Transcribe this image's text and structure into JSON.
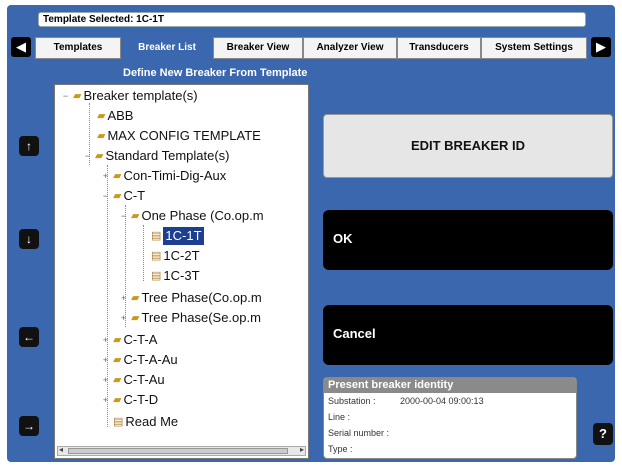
{
  "header": {
    "template_selected": "Template Selected: 1C-1T"
  },
  "tabs": [
    {
      "label": "Templates"
    },
    {
      "label": "Breaker List"
    },
    {
      "label": "Breaker View"
    },
    {
      "label": "Analyzer View"
    },
    {
      "label": "Transducers"
    },
    {
      "label": "System Settings"
    }
  ],
  "active_tab": "Breaker List",
  "subtitle": "Define New Breaker From Template",
  "side_buttons": [
    {
      "icon": "arrow-up-icon",
      "glyph": "↑"
    },
    {
      "icon": "arrow-down-icon",
      "glyph": "↓"
    },
    {
      "icon": "arrow-left-icon",
      "glyph": "←"
    },
    {
      "icon": "arrow-right-icon",
      "glyph": "→"
    }
  ],
  "tree": [
    {
      "label": "Breaker template(s)",
      "expander": "−",
      "icon": "folder"
    },
    {
      "label": "ABB",
      "icon": "folder"
    },
    {
      "label": "MAX CONFIG TEMPLATE",
      "icon": "folder"
    },
    {
      "label": "Standard Template(s)",
      "expander": "−",
      "icon": "folder"
    },
    {
      "label": "Con-Timi-Dig-Aux",
      "expander": "+",
      "icon": "folder"
    },
    {
      "label": "C-T",
      "expander": "−",
      "icon": "folder"
    },
    {
      "label": "One Phase (Co.op.m",
      "expander": "−",
      "icon": "folder"
    },
    {
      "label": "1C-1T",
      "icon": "doc",
      "selected": true
    },
    {
      "label": "1C-2T",
      "icon": "doc"
    },
    {
      "label": "1C-3T",
      "icon": "doc"
    },
    {
      "label": "Tree Phase(Co.op.m",
      "expander": "+",
      "icon": "folder"
    },
    {
      "label": "Tree Phase(Se.op.m",
      "expander": "+",
      "icon": "folder"
    },
    {
      "label": "C-T-A",
      "expander": "+",
      "icon": "folder"
    },
    {
      "label": "C-T-A-Au",
      "expander": "+",
      "icon": "folder"
    },
    {
      "label": "C-T-Au",
      "expander": "+",
      "icon": "folder"
    },
    {
      "label": "C-T-D",
      "expander": "+",
      "icon": "folder"
    },
    {
      "label": "Read Me",
      "icon": "doc"
    }
  ],
  "buttons": {
    "edit_breaker_id": "EDIT BREAKER ID",
    "ok": "OK",
    "cancel": "Cancel",
    "help": "?"
  },
  "identity": {
    "title": "Present breaker identity",
    "substation_label": "Substation :",
    "substation_value": "2000-00-04 09:00:13",
    "line_label": "Line :",
    "serial_label": "Serial number :",
    "type_label": "Type :"
  },
  "colors": {
    "background": "#3a67ad",
    "selected": "#1d3f8f"
  }
}
